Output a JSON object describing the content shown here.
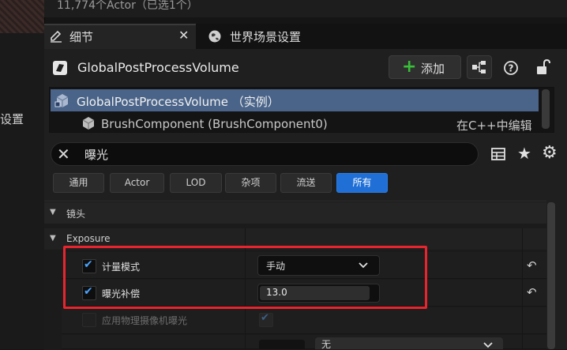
{
  "left": {
    "settings_label": "设置"
  },
  "outliner": {
    "actor_count": "11,774个Actor（已选1个）"
  },
  "tabs": {
    "details_label": "细节",
    "world_settings_label": "世界场景设置"
  },
  "details": {
    "actor_name": "GlobalPostProcessVolume",
    "add_label": "添加"
  },
  "components": {
    "root_label": "GlobalPostProcessVolume （实例）",
    "child_label": "BrushComponent (BrushComponent0)",
    "child_edit_label": "在C++中编辑"
  },
  "search": {
    "value": "曝光"
  },
  "filters": [
    "通用",
    "Actor",
    "LOD",
    "杂项",
    "流送",
    "所有"
  ],
  "active_filter": "所有",
  "categories": {
    "lens": "镜头",
    "exposure": "Exposure"
  },
  "properties": {
    "metering_mode": {
      "label": "计量模式",
      "value": "手动",
      "checked": true
    },
    "exposure_compensation": {
      "label": "曝光补偿",
      "value": "13.0",
      "checked": true
    },
    "apply_physical_camera": {
      "label": "应用物理摄像机曝光",
      "checked": false
    }
  },
  "partial_row": {
    "value": "无"
  },
  "colors": {
    "accent": "#1f6fd6",
    "selection": "#4a6489",
    "highlight": "#e8252e",
    "add_plus": "#38c038"
  }
}
